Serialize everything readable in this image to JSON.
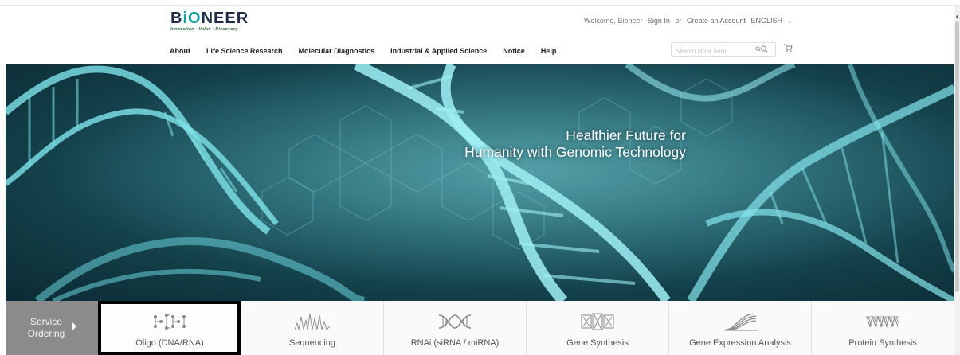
{
  "header": {
    "logo": {
      "name": "BiONEER",
      "tagline": "Innovation · Value · Discovery"
    },
    "welcome_text": "Welcome, Bioneer",
    "sign_in": "Sign In",
    "or_text": "or",
    "create_account": "Create an Account",
    "language": "ENGLISH",
    "nav": [
      "About",
      "Life Science Research",
      "Molecular Diagnostics",
      "Industrial & Applied Science",
      "Notice",
      "Help"
    ],
    "search_placeholder": "Search store here...",
    "icons": {
      "search": "search-icon",
      "cart": "cart-icon"
    }
  },
  "hero": {
    "line1": "Healthier Future for",
    "line2": "Humanity with Genomic Technology"
  },
  "services": {
    "label_line1": "Service",
    "label_line2": "Ordering",
    "items": [
      {
        "label": "Oligo (DNA/RNA)",
        "icon": "oligo-icon",
        "selected": true
      },
      {
        "label": "Sequencing",
        "icon": "sequencing-icon",
        "selected": false
      },
      {
        "label": "RNAi (siRNA / miRNA)",
        "icon": "rnai-icon",
        "selected": false
      },
      {
        "label": "Gene Synthesis",
        "icon": "gene-synthesis-icon",
        "selected": false
      },
      {
        "label": "Gene Expression Analysis",
        "icon": "gene-expression-icon",
        "selected": false
      },
      {
        "label": "Protein Synthesis",
        "icon": "protein-synthesis-icon",
        "selected": false
      }
    ]
  },
  "colors": {
    "accent": "#11a3a0",
    "hero_dark": "#0c2a33",
    "selection": "#000000",
    "service_label_bg": "#8b8b8b"
  }
}
